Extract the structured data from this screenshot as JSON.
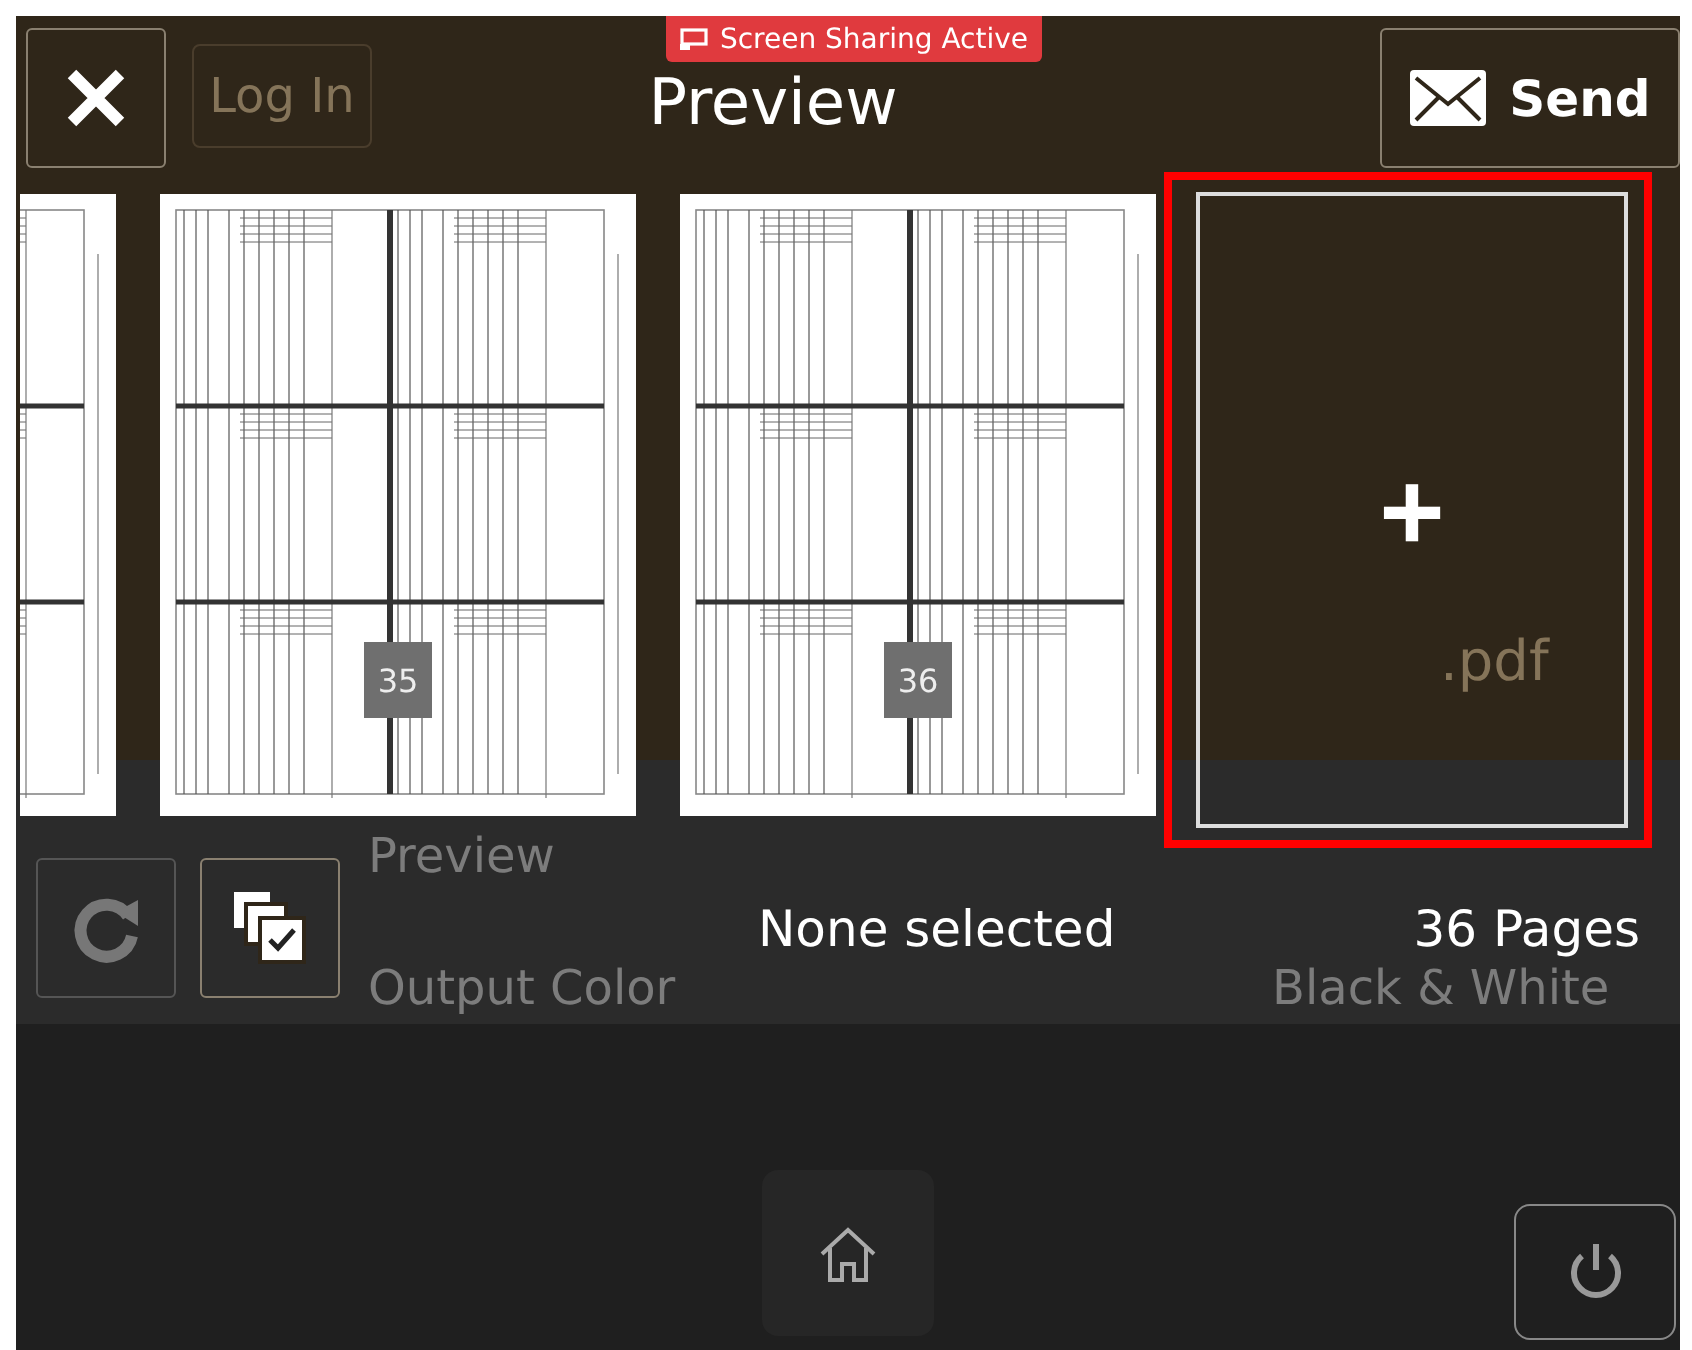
{
  "banner": {
    "text": "Screen Sharing Active"
  },
  "header": {
    "title": "Preview",
    "send_label": "Send"
  },
  "background": {
    "login": "Log In",
    "extension": ".pdf",
    "rows": [
      {
        "label": "Preview"
      },
      {
        "label": "Output Color",
        "value": "Black & White"
      }
    ]
  },
  "pages": [
    {
      "partial": true
    },
    {
      "number": "35",
      "partial": false
    },
    {
      "number": "36",
      "partial": false
    }
  ],
  "add_page": {
    "symbol": "+",
    "highlighted": true
  },
  "footer": {
    "status": "None selected",
    "count": "36 Pages"
  }
}
